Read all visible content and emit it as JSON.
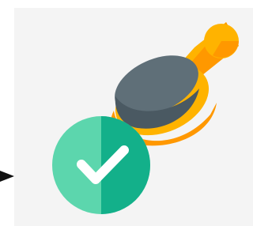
{
  "illustration": {
    "icon": "approval-stamp-icon",
    "pointer_icon": "arrow-pointer-icon",
    "colors": {
      "panel_background": "#f4f4f4",
      "handle_light": "#ffb300",
      "handle_dark": "#ff8f00",
      "stamp_body_light": "#5f6f78",
      "stamp_body_dark": "#4a5962",
      "stamp_ring_light": "#ffb300",
      "stamp_ring_dark": "#ff9800",
      "check_badge_light": "#5cd6ad",
      "check_badge_dark": "#13b08a",
      "check_mark": "#ffffff",
      "pointer": "#111111"
    }
  }
}
